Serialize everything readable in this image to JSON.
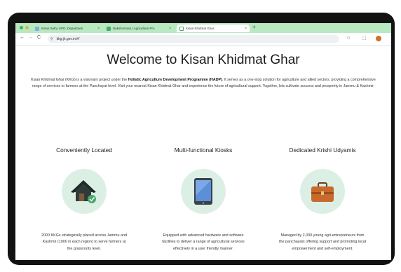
{
  "browser": {
    "tabs": [
      {
        "label": "Kisan Sathi, KPD, Departmen",
        "close": "×"
      },
      {
        "label": "Dakshi Kisan | Agriculture Pro",
        "close": "×"
      },
      {
        "label": "Kisan Khidmat Ghar",
        "close": "×"
      }
    ],
    "new_tab": "+",
    "url": "kkg.jk.gov.in/#/",
    "back": "←",
    "forward": "→",
    "reload": "C",
    "star": "☆",
    "extensions": "⬚",
    "colors": {
      "tabstrip": "#b9e9c0",
      "accent": "#4aa86b"
    }
  },
  "page": {
    "title": "Welcome to Kisan Khidmat Ghar",
    "intro_before": "Kisan Khidmat Ghar (KKG) is a visionary project under the ",
    "intro_bold": "Holistic Agriculture Development Programme (HADP)",
    "intro_after": ". It serves as a one-stop solution for agriculture and allied sectors, providing a comprehensive range of services to farmers at the Panchayat level. Visit your nearest Kisan Khidmat Ghar and experience the future of agricultural support. Together, lets cultivate success and prosperity in Jammu & Kashmir.",
    "features": [
      {
        "title": "Conveniently Located",
        "icon": "house-icon",
        "description": "2000 KKGs strategically placed across Jammu and Kashmir (1000 in each region) to serve farmers at the grassroots level."
      },
      {
        "title": "Multi-functional Kiosks",
        "icon": "tablet-icon",
        "description": "Equipped with advanced hardware and software facilities to deliver a range of agricultural services effectively in a user friendly manner."
      },
      {
        "title": "Dedicated Krishi Udyamis",
        "icon": "briefcase-icon",
        "description": "Managed by 2,000 young agri-entrepreneurs from the panchayats offering support and promoting local empowerment and self-employment."
      }
    ]
  }
}
